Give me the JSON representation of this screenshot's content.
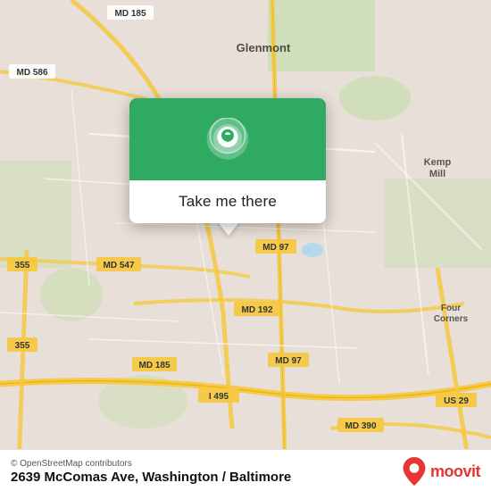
{
  "map": {
    "attribution": "© OpenStreetMap contributors",
    "address": "2639 McComas Ave, Washington / Baltimore",
    "center_lat": 39.04,
    "center_lng": -77.02
  },
  "popup": {
    "button_label": "Take me there",
    "icon_alt": "location-pin"
  },
  "moovit": {
    "logo_text": "moovit",
    "accent_color": "#e63535"
  },
  "colors": {
    "map_bg": "#e8e0d8",
    "green_accent": "#2eaa62",
    "road_major": "#f5c842",
    "road_minor": "#ffffff",
    "road_highway": "#e8b84b",
    "water": "#a8d4f0",
    "park": "#c8ddb0"
  },
  "roads": {
    "labels": [
      "MD 185",
      "MD 586",
      "MD 97",
      "MD 547",
      "MD 192",
      "MD 390",
      "US 29",
      "I-495",
      "355"
    ]
  }
}
